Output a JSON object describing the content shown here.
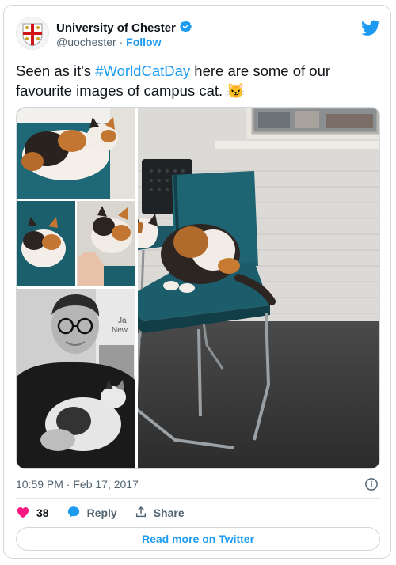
{
  "account": {
    "name": "University of Chester",
    "handle": "@uochester",
    "separator": "·",
    "follow_label": "Follow"
  },
  "tweet": {
    "text_before": "Seen as it's ",
    "hashtag": "#WorldCatDay",
    "text_after": " here are some of our favourite images of campus cat. ",
    "emoji": "😼"
  },
  "media": {
    "sign_text_1": "Ja",
    "sign_text_2": "New"
  },
  "meta": {
    "timestamp": "10:59 PM · Feb 17, 2017"
  },
  "actions": {
    "like_count": "38",
    "reply_label": "Reply",
    "share_label": "Share"
  },
  "footer": {
    "read_more_label": "Read more on Twitter"
  },
  "colors": {
    "accent": "#1d9bf0",
    "like": "#f91880",
    "verified": "#1d9bf0"
  },
  "icons": [
    "avatar-crest",
    "verified-badge-icon",
    "twitter-bird-icon",
    "info-icon",
    "heart-icon",
    "reply-bubble-icon",
    "share-icon"
  ]
}
